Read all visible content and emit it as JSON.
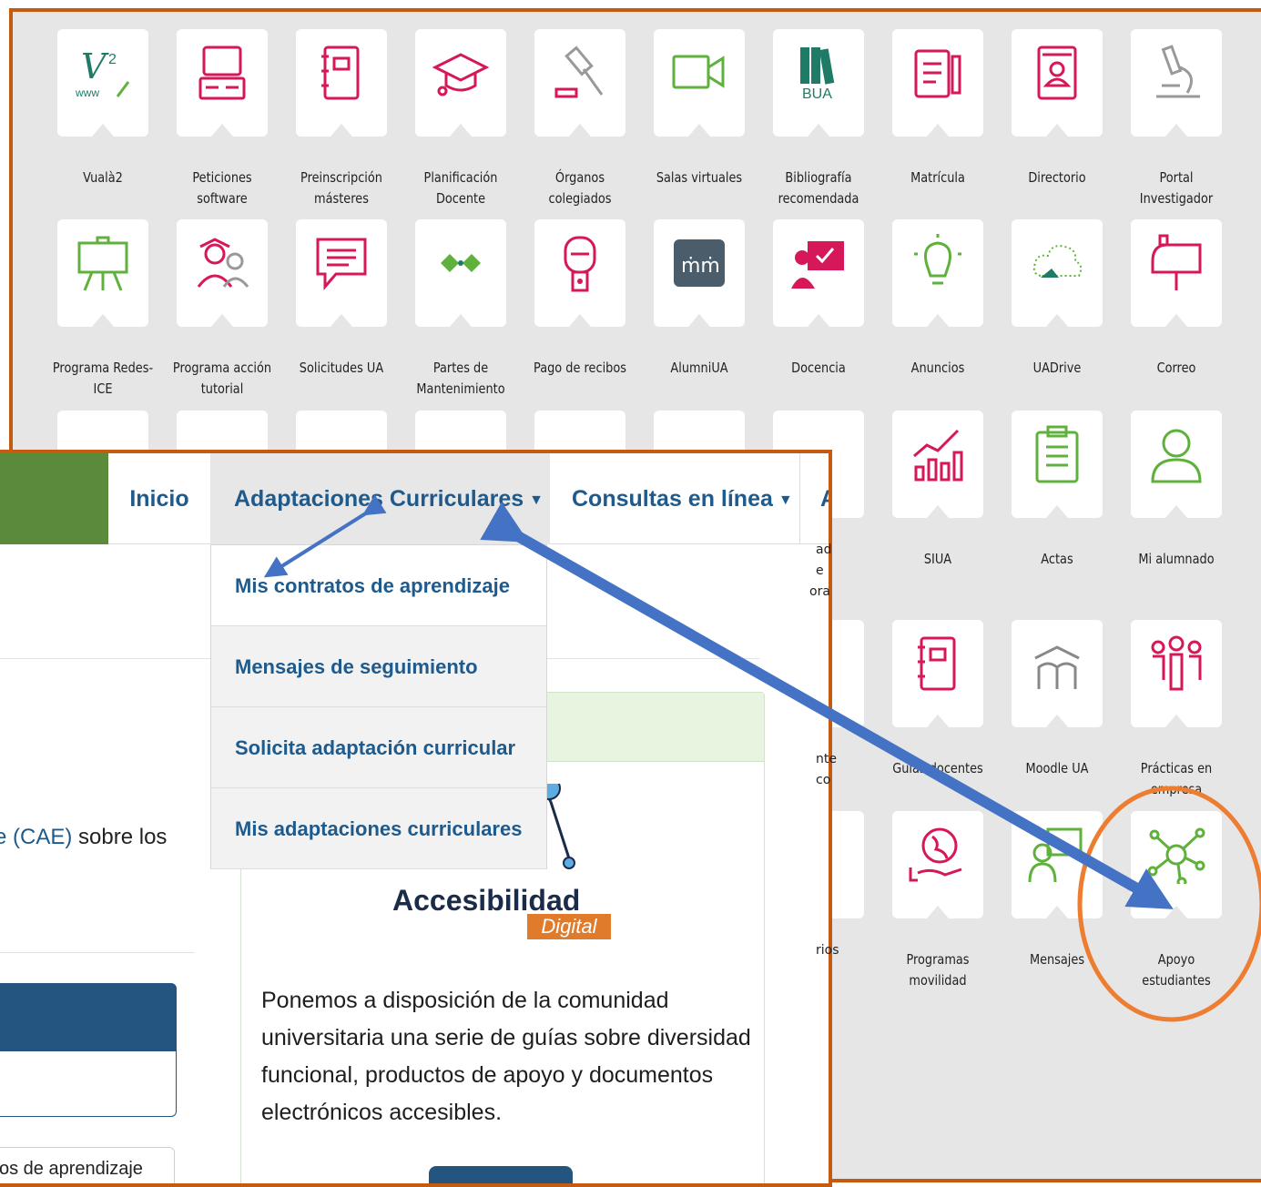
{
  "launcher": {
    "apps": [
      {
        "label": "Vualà2",
        "icon": "vuala-icon"
      },
      {
        "label": "Peticiones software",
        "icon": "computer-icon"
      },
      {
        "label": "Preinscripción másteres",
        "icon": "notebook-icon"
      },
      {
        "label": "Planificación Docente",
        "icon": "graduation-cap-icon"
      },
      {
        "label": "Órganos colegiados",
        "icon": "gavel-icon"
      },
      {
        "label": "Salas virtuales",
        "icon": "video-camera-icon"
      },
      {
        "label": "Bibliografía recomendada",
        "icon": "books-bua-icon"
      },
      {
        "label": "Matrícula",
        "icon": "form-pencil-icon"
      },
      {
        "label": "Directorio",
        "icon": "contact-book-icon"
      },
      {
        "label": "Portal Investigador",
        "icon": "microscope-icon"
      },
      {
        "label": "Programa Redes-ICE",
        "icon": "easel-icon"
      },
      {
        "label": "Programa acción tutorial",
        "icon": "tutor-students-icon"
      },
      {
        "label": "Solicitudes UA",
        "icon": "speech-bubble-icon"
      },
      {
        "label": "Partes de Mantenimiento",
        "icon": "diamonds-icon"
      },
      {
        "label": "Pago de recibos",
        "icon": "parking-meter-icon"
      },
      {
        "label": "AlumniUA",
        "icon": "alumni-icon"
      },
      {
        "label": "Docencia",
        "icon": "teacher-board-icon"
      },
      {
        "label": "Anuncios",
        "icon": "lightbulb-icon"
      },
      {
        "label": "UADrive",
        "icon": "cloud-icon"
      },
      {
        "label": "Correo",
        "icon": "mailbox-icon"
      },
      {
        "label": "SIUA",
        "icon": "growth-chart-icon"
      },
      {
        "label": "Actas",
        "icon": "clipboard-icon"
      },
      {
        "label": "Mi alumnado",
        "icon": "student-icon"
      },
      {
        "label": "Guías docentes",
        "icon": "notebook-icon"
      },
      {
        "label": "Moodle UA",
        "icon": "moodle-icon"
      },
      {
        "label": "Prácticas en empresa",
        "icon": "people-network-icon"
      },
      {
        "label": "Programas movilidad",
        "icon": "globe-hand-icon"
      },
      {
        "label": "Mensajes",
        "icon": "messages-icon"
      },
      {
        "label": "Apoyo estudiantes",
        "icon": "network-node-icon"
      }
    ],
    "partial_labels": [
      "ad",
      "e",
      "ora",
      "nte",
      "co",
      "rios"
    ],
    "brand_green": "#5fb13c",
    "brand_pink": "#d6175a",
    "brand_teal": "#1f7b66"
  },
  "nav": {
    "inicio": "Inicio",
    "adaptaciones": "Adaptaciones Curriculares",
    "consultas": "Consultas en línea",
    "more": "A"
  },
  "dropdown": {
    "items": [
      "Mis contratos de aprendizaje",
      "Mensajes de seguimiento",
      "Solicita adaptación curricular",
      "Mis adaptaciones curriculares"
    ]
  },
  "content": {
    "partial_link": "e (CAE)",
    "partial_text": " sobre los",
    "tab_label": "os de aprendizaje"
  },
  "card": {
    "logo_title": "Accesibilidad",
    "logo_subtitle": "Digital",
    "text": "Ponemos a disposición de la comunidad universitaria una serie de guías sobre diversidad funcional, productos de apoyo y documentos electrónicos accesibles."
  },
  "annotations": {
    "arrow_color": "#4472c4",
    "circle_color": "#ed7d31",
    "border_color": "#c55a11"
  }
}
